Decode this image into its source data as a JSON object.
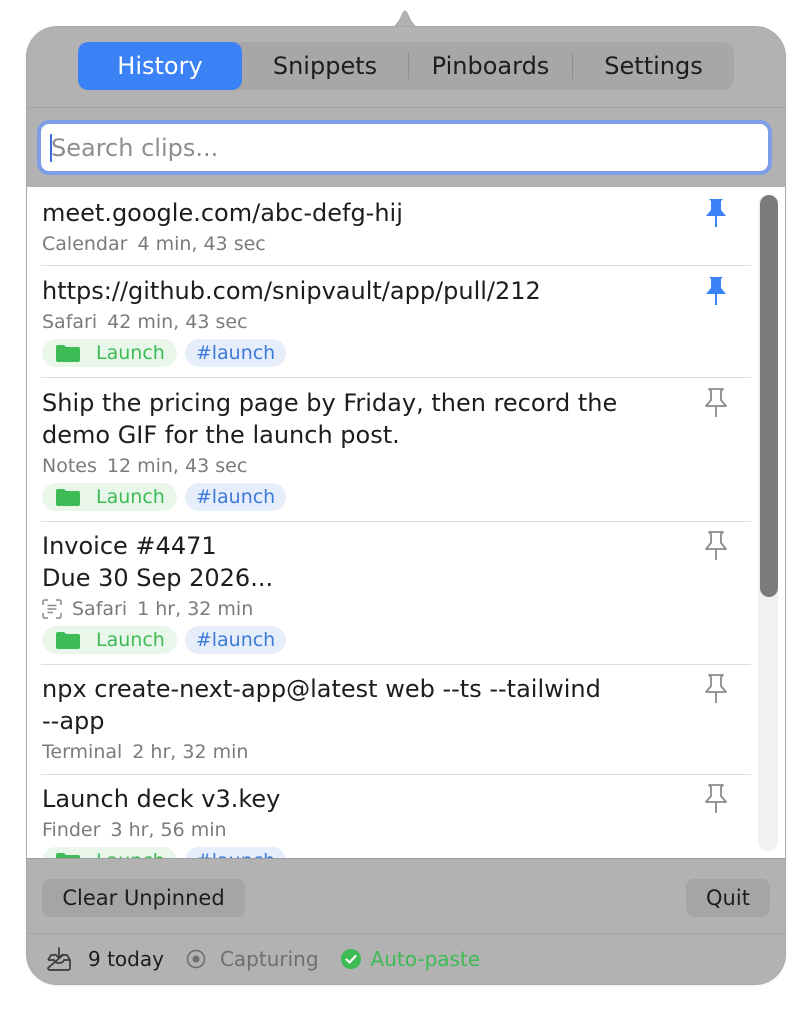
{
  "tabs": [
    {
      "label": "History",
      "active": true
    },
    {
      "label": "Snippets",
      "active": false
    },
    {
      "label": "Pinboards",
      "active": false
    },
    {
      "label": "Settings",
      "active": false
    }
  ],
  "search": {
    "placeholder": "Search clips...",
    "value": ""
  },
  "clips": [
    {
      "lines": [
        "meet.google.com/abc-defg-hij"
      ],
      "source": "Calendar",
      "age": "4 min, 43 sec",
      "pinned": true,
      "tags": []
    },
    {
      "lines": [
        "https://github.com/snipvault/app/pull/212"
      ],
      "source": "Safari",
      "age": "42 min, 43 sec",
      "pinned": true,
      "tags": [
        "Launch",
        "#launch"
      ]
    },
    {
      "lines": [
        "Ship the pricing page by Friday, then record the",
        "demo GIF for the launch post."
      ],
      "source": "Notes",
      "age": "12 min, 43 sec",
      "pinned": false,
      "tags": [
        "Launch",
        "#launch"
      ]
    },
    {
      "lines": [
        "Invoice #4471",
        "Due 30 Sep 2026..."
      ],
      "source": "Safari",
      "age": "1 hr, 32 min",
      "pinned": false,
      "ocr": true,
      "tags": [
        "Launch",
        "#launch"
      ]
    },
    {
      "lines": [
        "npx create-next-app@latest web --ts --tailwind",
        "--app"
      ],
      "source": "Terminal",
      "age": "2 hr, 32 min",
      "pinned": false,
      "tags": []
    },
    {
      "lines": [
        "Launch deck v3.key"
      ],
      "source": "Finder",
      "age": "3 hr, 56 min",
      "pinned": false,
      "tags": [
        "Launch",
        "#launch"
      ]
    }
  ],
  "footer": {
    "clear_label": "Clear Unpinned",
    "quit_label": "Quit"
  },
  "status": {
    "count": "9 today",
    "capturing": "Capturing",
    "autopaste": "Auto-paste"
  },
  "colors": {
    "accent": "#3a82f6",
    "green": "#3dbb54",
    "popover_bg": "#b2b2b2"
  }
}
